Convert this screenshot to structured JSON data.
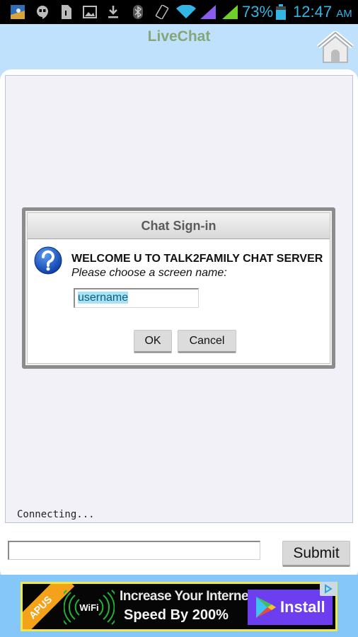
{
  "status_bar": {
    "icons": [
      "photo-widget-icon",
      "hangouts-icon",
      "file-icon",
      "gallery-icon",
      "download-icon",
      "bluetooth-icon",
      "rotation-icon",
      "wifi-icon",
      "signal-purple-icon",
      "signal-green-icon",
      "battery-icon"
    ],
    "battery": "73%",
    "time": "12:47",
    "ampm": "AM",
    "accent_color": "#33b5e5"
  },
  "header": {
    "title": "LiveChat",
    "home_icon": "home-icon"
  },
  "chat": {
    "status_text": "Connecting...",
    "message_input_value": "",
    "submit_label": "Submit"
  },
  "dialog": {
    "title": "Chat Sign-in",
    "icon": "question-icon",
    "welcome": "WELCOME U TO TALK2FAMILY CHAT SERVER",
    "prompt": "Please choose a screen name:",
    "input_value": "username",
    "ok_label": "OK",
    "cancel_label": "Cancel"
  },
  "ad": {
    "brand": "APUS",
    "line1": "Increase Your Internet",
    "line2": "Speed By 200%",
    "wifi_label": "WiFi",
    "install_label": "Install",
    "colors": {
      "border": "#f2e84a",
      "ribbon": "#f3a21a",
      "button": "#6c3ef0"
    }
  }
}
